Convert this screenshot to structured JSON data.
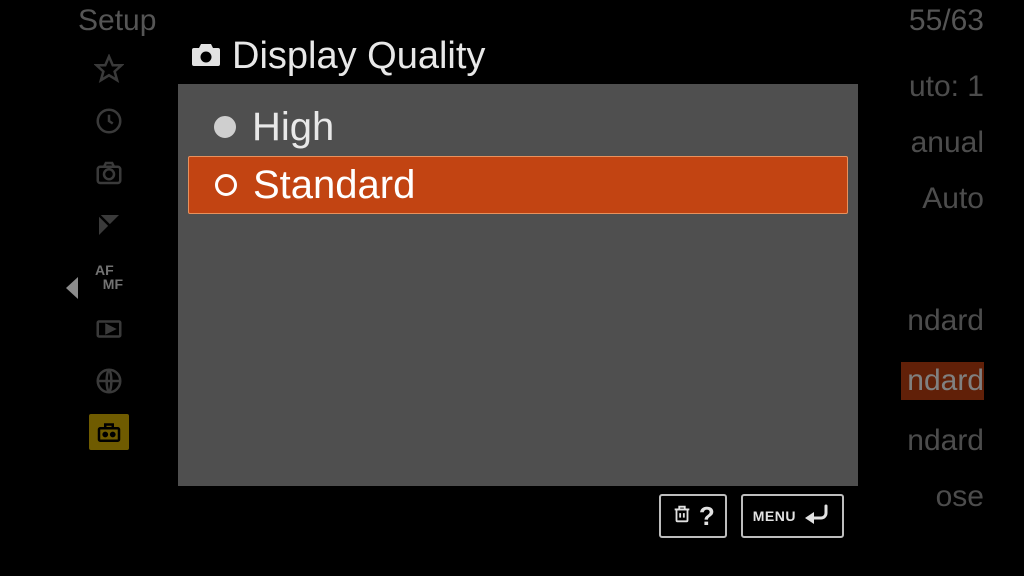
{
  "background": {
    "header": "Setup",
    "page_indicator": "55/63",
    "left_arrow": "◀",
    "sidebar_icons": [
      "star",
      "clock",
      "camera",
      "exposure",
      "afmf",
      "playback",
      "globe",
      "toolbox"
    ],
    "values": {
      "v1": "uto: 1",
      "v2": "anual",
      "v3": "Auto",
      "v4": "ndard",
      "v5": "ndard",
      "v6": "ndard",
      "v7": "ose"
    }
  },
  "modal": {
    "title": "Display Quality",
    "options": [
      {
        "label": "High",
        "selected": false
      },
      {
        "label": "Standard",
        "selected": true
      }
    ],
    "footer": {
      "help": "?",
      "menu": "MENU"
    }
  }
}
